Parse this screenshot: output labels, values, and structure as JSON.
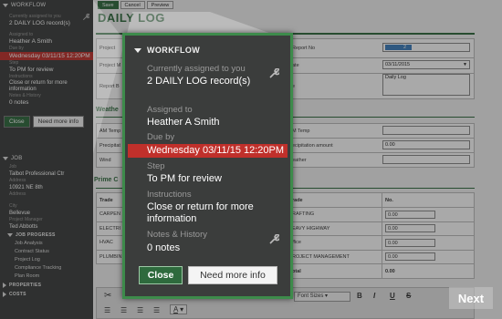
{
  "sidebar": {
    "workflow_title": "WORKFLOW",
    "assigned_label": "Currently assigned to you",
    "assigned_value": "2 DAILY LOG record(s)",
    "assigned_to_label": "Assigned to",
    "assigned_to_value": "Heather A Smith",
    "due_label": "Due by",
    "due_value": "Wednesday 03/11/15 12:20PM",
    "step_label": "Step",
    "step_value": "To PM for review",
    "instructions_label": "Instructions",
    "instructions_value": "Close or return for more information",
    "notes_label": "Notes & History",
    "notes_value": "0 notes",
    "close_btn": "Close",
    "need_btn": "Need more info",
    "job_title": "JOB",
    "job_label": "Job",
    "job_value": "Talbot Professional Ctr",
    "address_label": "Address",
    "address_value": "10921 NE 8th",
    "address2_label": "Address",
    "city_label": "City",
    "city_value": "Bellevue",
    "pm_label": "Project Manager",
    "pm_value": "Ted Abbotts",
    "job_progress": "JOB PROGRESS",
    "progress_items": [
      "Job Analysis",
      "Contract Status",
      "Project Log",
      "Compliance Tracking",
      "Plan Room"
    ],
    "properties": "PROPERTIES",
    "costs": "COSTS"
  },
  "toolbar": {
    "save": "Save",
    "cancel": "Cancel",
    "preview": "Preview"
  },
  "page_title": "DAILY LOG",
  "form": {
    "project_label": "Project",
    "project_m_label": "Project M",
    "report_b_label": "Report B",
    "report_no_label": "Report No",
    "report_no_value": "2",
    "date_label": "ate",
    "date_value": "03/11/2015",
    "desc_label": "e",
    "desc_value": "Daily Log"
  },
  "weather": {
    "section": "Weathe",
    "am_temp_label": "AM Temp",
    "am_temp_label2": "M Temp",
    "precip_label": "Precipitat",
    "precip_amount_label": "ecipitation amount",
    "precip_amount_value": "0.00",
    "wind_label": "Wind",
    "weather_label": "eather"
  },
  "prime": {
    "section": "Prime C",
    "trade_head": "Trade",
    "trade_head2": "rade",
    "no_head": "No.",
    "left_rows": [
      "CARPEN",
      "ELECTRI",
      "HVAC",
      "PLUMBIN"
    ],
    "right_rows": [
      "RAFTING",
      "EAVY HIGHWAY",
      "ffice",
      "ROJECT MANAGEMENT"
    ],
    "values": [
      "0.00",
      "0.00",
      "0.00",
      "0.00"
    ],
    "total_label": "otal",
    "total_value": "0.00"
  },
  "editor": {
    "font_sizes": "Font Sizes",
    "bold": "B",
    "italic": "I",
    "underline": "U",
    "strike": "S",
    "font_color": "A"
  },
  "popup": {
    "title": "WORKFLOW",
    "assigned_label": "Currently assigned to you",
    "assigned_value": "2 DAILY LOG record(s)",
    "assigned_to_label": "Assigned to",
    "assigned_to_value": "Heather A Smith",
    "due_label": "Due by",
    "due_value": "Wednesday 03/11/15 12:20PM",
    "step_label": "Step",
    "step_value": "To PM for review",
    "instructions_label": "Instructions",
    "instructions_value_1": "Close or return for more",
    "instructions_value_2": "information",
    "notes_label": "Notes & History",
    "notes_value": "0 notes",
    "close_btn": "Close",
    "need_btn": "Need more info"
  },
  "next_btn": "Next",
  "colors": {
    "accent": "#2e6a3d",
    "due_red": "#c0302b",
    "panel": "#3b3d3c",
    "highlight_border": "#3d8b4b"
  }
}
